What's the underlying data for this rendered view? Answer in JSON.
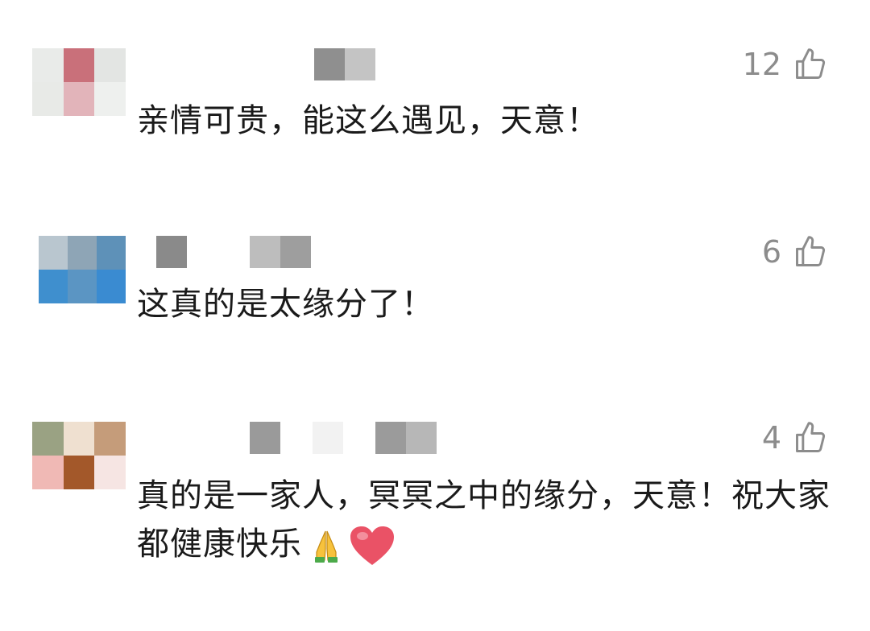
{
  "comments": [
    {
      "text": "亲情可贵，能这么遇见，天意！",
      "likes": "12"
    },
    {
      "text": "这真的是太缘分了！",
      "likes": "6"
    },
    {
      "text": "真的是一家人，冥冥之中的缘分，天意！祝大家都健康快乐",
      "likes": "4"
    }
  ],
  "icons": {
    "like": "thumbs-up-icon",
    "pray": "folded-hands-emoji",
    "heart": "red-heart-emoji"
  },
  "colors": {
    "text": "#1a1a1a",
    "likes": "#8c8c8c",
    "heart": "#e84a5f"
  }
}
